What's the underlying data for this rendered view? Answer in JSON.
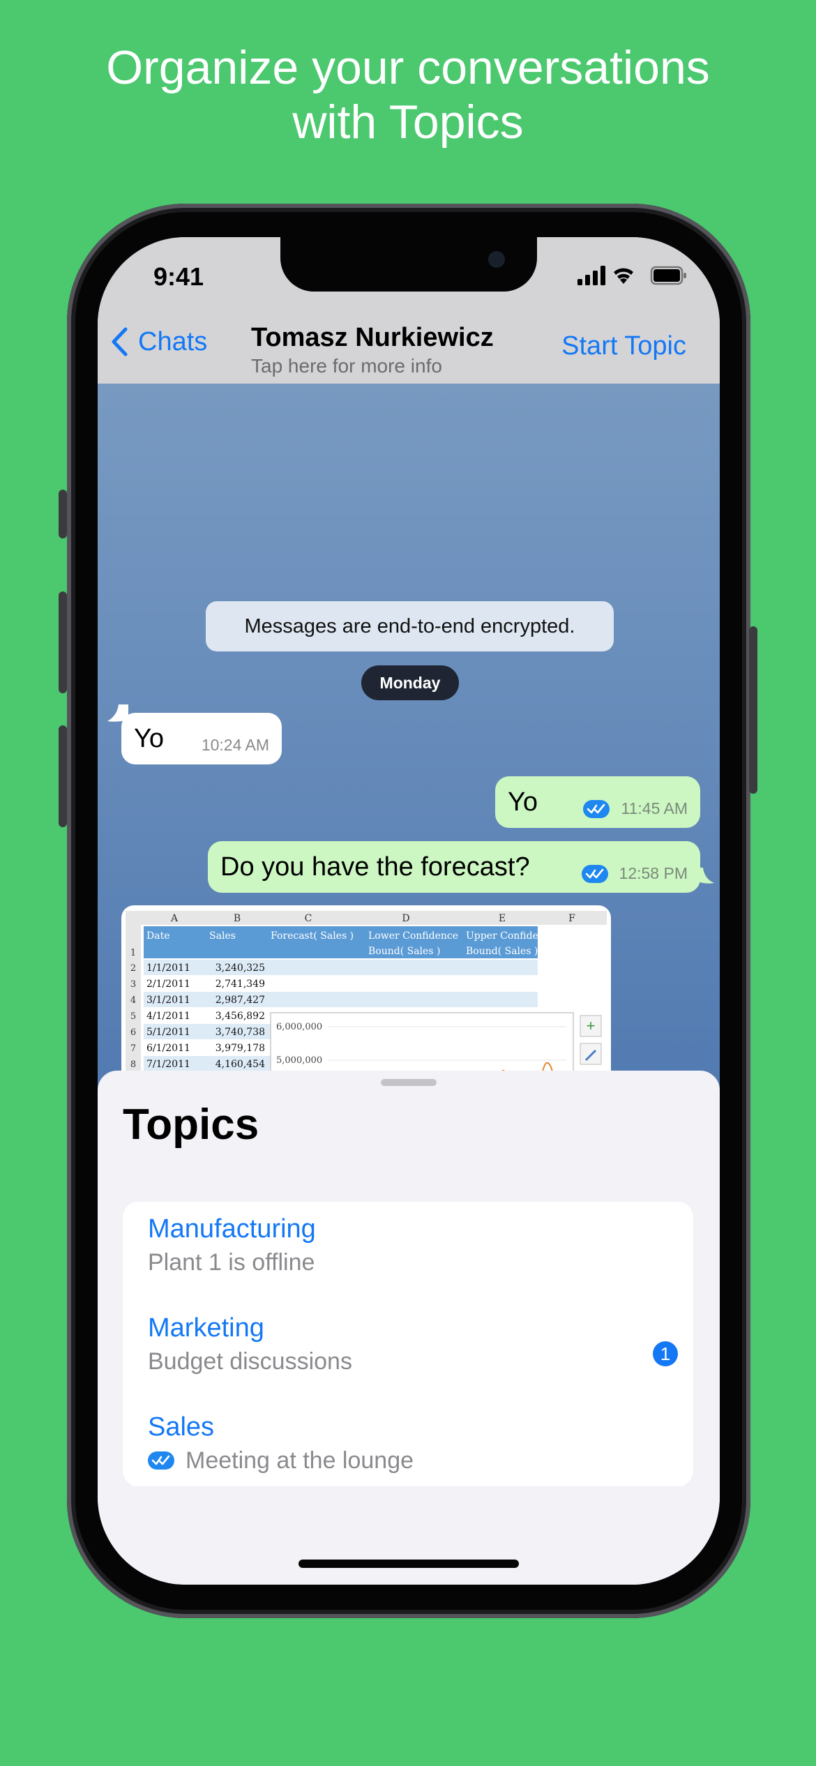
{
  "headline": {
    "line1": "Organize your conversations",
    "line2": "with Topics"
  },
  "status_bar": {
    "time": "9:41",
    "icons": [
      "cellular-signal-icon",
      "wifi-icon",
      "battery-icon"
    ]
  },
  "nav": {
    "back_label": "Chats",
    "contact_name": "Tomasz Nurkiewicz",
    "contact_subtitle": "Tap here for more info",
    "action_label": "Start Topic"
  },
  "chat": {
    "system_message": "Messages are end-to-end encrypted.",
    "day_label": "Monday",
    "messages": [
      {
        "direction": "incoming",
        "text": "Yo",
        "time": "10:24 AM"
      },
      {
        "direction": "outgoing",
        "text": "Yo",
        "time": "11:45 AM",
        "status": "read"
      },
      {
        "direction": "outgoing",
        "text": "Do you have the forecast?",
        "time": "12:58 PM",
        "status": "read"
      }
    ],
    "attachment": {
      "type": "spreadsheet-image",
      "column_letters": [
        "A",
        "B",
        "C",
        "D",
        "E",
        "F"
      ],
      "headers": [
        "Date",
        "Sales",
        "Forecast( Sales )",
        "Lower Confidence",
        "Upper Confidence"
      ],
      "headers_line2": [
        "",
        "",
        "",
        "Bound( Sales )",
        "Bound( Sales )"
      ],
      "row_numbers": [
        "1",
        "2",
        "3",
        "4",
        "5",
        "6",
        "7",
        "8"
      ],
      "rows": [
        [
          "1/1/2011",
          "3,240,325"
        ],
        [
          "2/1/2011",
          "2,741,349"
        ],
        [
          "3/1/2011",
          "2,987,427"
        ],
        [
          "4/1/2011",
          "3,456,892"
        ],
        [
          "5/1/2011",
          "3,740,738"
        ],
        [
          "6/1/2011",
          "3,979,178"
        ],
        [
          "7/1/2011",
          "4,160,454"
        ]
      ],
      "chart_ticks": [
        "6,000,000",
        "5,000,000"
      ]
    }
  },
  "topics_sheet": {
    "title": "Topics",
    "items": [
      {
        "name": "Manufacturing",
        "subtitle": "Plant 1 is offline",
        "badge": null,
        "status": null
      },
      {
        "name": "Marketing",
        "subtitle": "Budget discussions",
        "badge": "1",
        "status": null
      },
      {
        "name": "Sales",
        "subtitle": "Meeting at the lounge",
        "badge": null,
        "status": "read"
      }
    ]
  },
  "colors": {
    "background": "#4cc86f",
    "accent": "#1478f5",
    "outgoing_bubble": "#cdf7c2",
    "incoming_bubble": "#ffffff"
  }
}
